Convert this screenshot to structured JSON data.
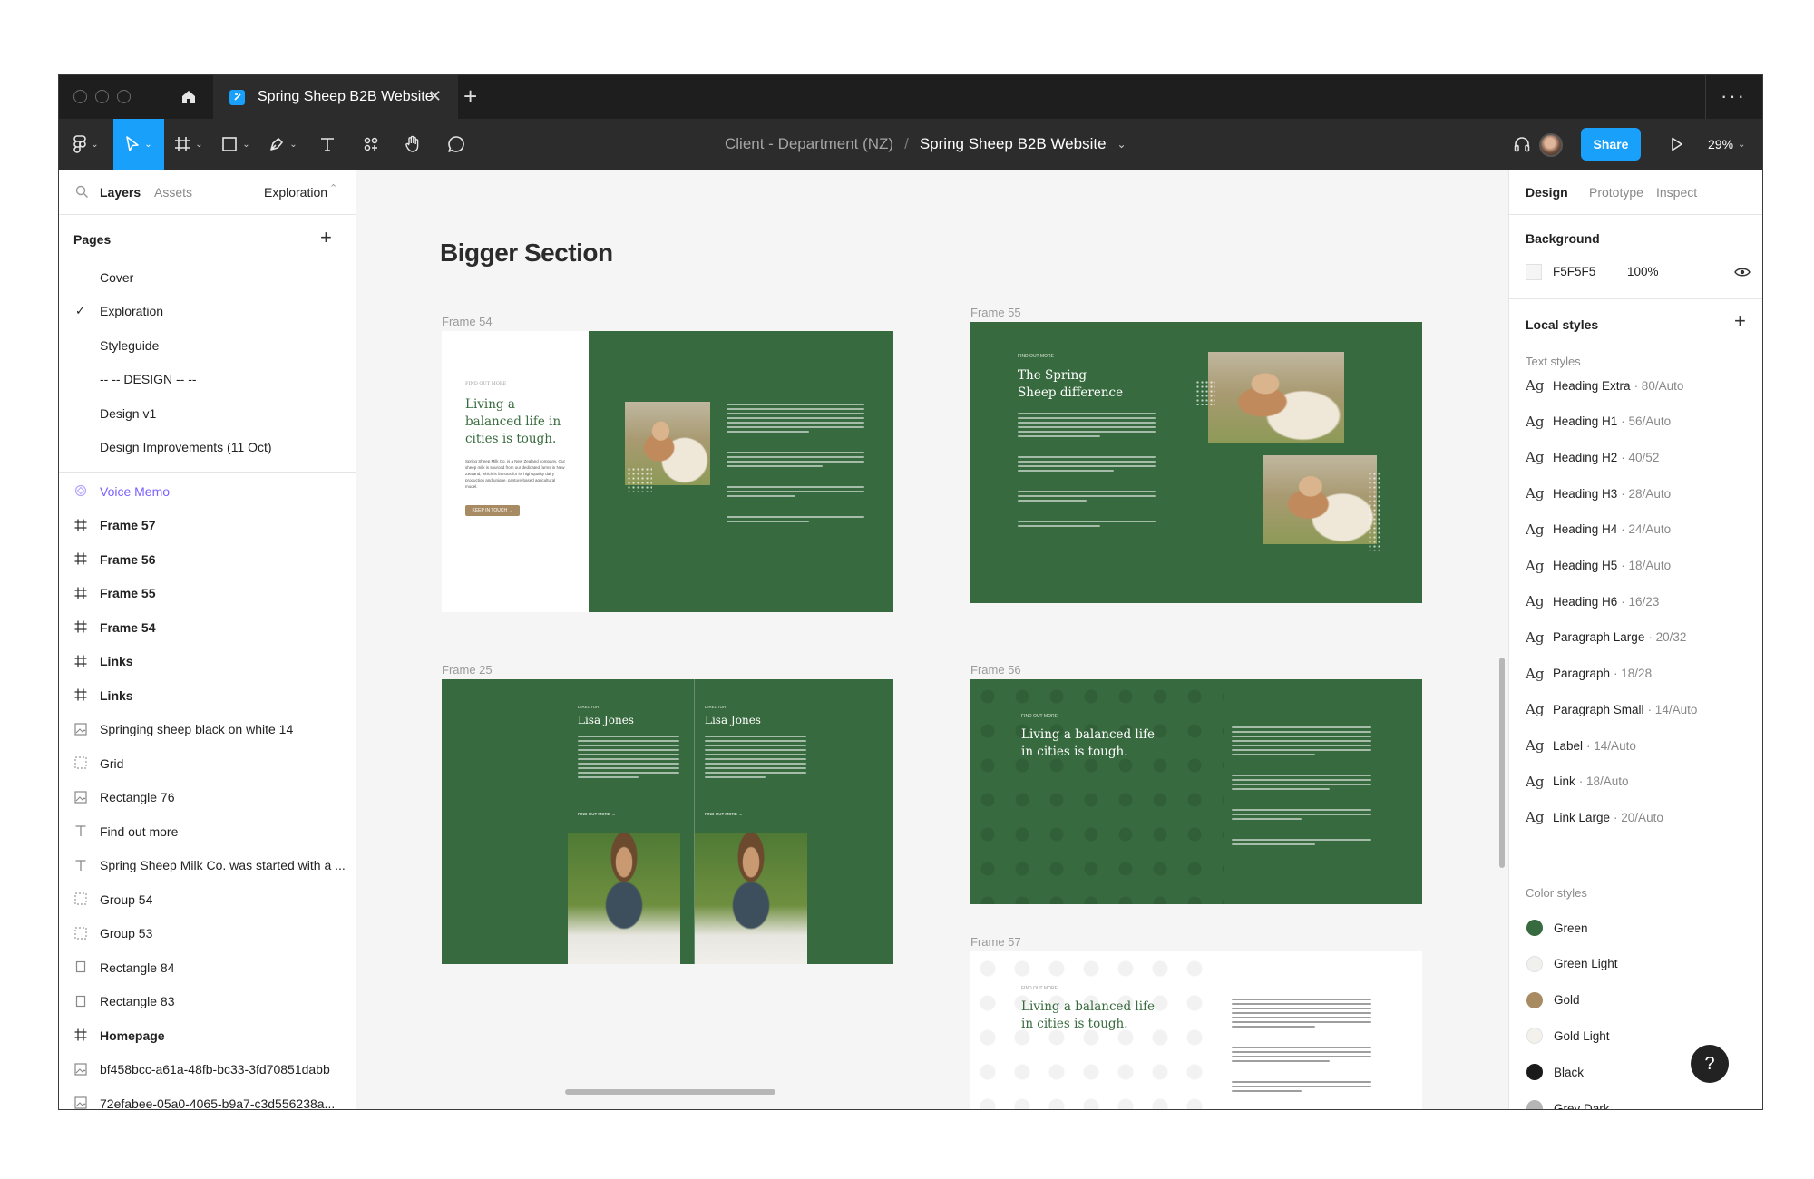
{
  "window": {
    "tab_title": "Spring Sheep B2B Website",
    "tab_close": "✕",
    "new_tab": "+",
    "more": "···"
  },
  "toolbar": {
    "breadcrumb_department": "Client - Department (NZ)",
    "breadcrumb_sep": "/",
    "breadcrumb_file": "Spring Sheep B2B Website",
    "share_label": "Share",
    "zoom": "29%"
  },
  "left_panel": {
    "tabs": {
      "layers": "Layers",
      "assets": "Assets",
      "page_selector": "Exploration"
    },
    "pages_title": "Pages",
    "add": "+",
    "pages": [
      {
        "label": "Cover",
        "selected": false
      },
      {
        "label": "Exploration",
        "selected": true
      },
      {
        "label": "Styleguide",
        "selected": false
      },
      {
        "label": "-- -- DESIGN -- --",
        "selected": false
      },
      {
        "label": "Design v1",
        "selected": false
      },
      {
        "label": "Design Improvements (11 Oct)",
        "selected": false
      }
    ],
    "layers": [
      {
        "label": "Voice Memo",
        "icon": "component-icon"
      },
      {
        "label": "Frame 57",
        "icon": "frame-icon"
      },
      {
        "label": "Frame 56",
        "icon": "frame-icon"
      },
      {
        "label": "Frame 55",
        "icon": "frame-icon"
      },
      {
        "label": "Frame 54",
        "icon": "frame-icon"
      },
      {
        "label": "Links",
        "icon": "frame-icon"
      },
      {
        "label": "Links",
        "icon": "frame-icon"
      },
      {
        "label": "Springing sheep black on white 14",
        "icon": "image-icon"
      },
      {
        "label": "Grid",
        "icon": "group-icon"
      },
      {
        "label": "Rectangle 76",
        "icon": "image-icon"
      },
      {
        "label": "Find out more",
        "icon": "text-icon"
      },
      {
        "label": "Spring Sheep Milk Co. was started with a ...",
        "icon": "text-icon"
      },
      {
        "label": "Group 54",
        "icon": "group-icon"
      },
      {
        "label": "Group 53",
        "icon": "group-icon"
      },
      {
        "label": "Rectangle 84",
        "icon": "rectangle-icon"
      },
      {
        "label": "Rectangle 83",
        "icon": "rectangle-icon"
      },
      {
        "label": "Homepage",
        "icon": "frame-icon"
      },
      {
        "label": "bf458bcc-a61a-48fb-bc33-3fd70851dabb",
        "icon": "image-icon"
      },
      {
        "label": "72efabee-05a0-4065-b9a7-c3d556238a...",
        "icon": "image-icon"
      }
    ]
  },
  "canvas": {
    "section_title": "Bigger Section",
    "frames": {
      "f54": {
        "label": "Frame 54",
        "eyebrow": "FIND OUT MORE",
        "heading": "Living a balanced life in cities is tough.",
        "body": "Spring Sheep Milk Co. is a New Zealand company. Our sheep milk is sourced from our dedicated farms in New Zealand, which is famous for its high quality dairy production and unique, pasture-based agricultural model.",
        "button": "KEEP IN TOUCH →"
      },
      "f55": {
        "label": "Frame 55",
        "eyebrow": "FIND OUT MORE",
        "heading": "The Spring Sheep difference"
      },
      "f25": {
        "label": "Frame 25",
        "eyebrow": "DIRECTOR",
        "name": "Lisa Jones",
        "link": "FIND OUT MORE →"
      },
      "f56": {
        "label": "Frame 56",
        "eyebrow": "FIND OUT MORE",
        "heading": "Living a balanced life in cities is tough."
      },
      "f57": {
        "label": "Frame 57",
        "eyebrow": "FIND OUT MORE",
        "heading": "Living a balanced life in cities is tough."
      }
    }
  },
  "right_panel": {
    "tabs": {
      "design": "Design",
      "prototype": "Prototype",
      "inspect": "Inspect"
    },
    "background_title": "Background",
    "background_hex": "F5F5F5",
    "background_opacity": "100%",
    "local_styles_title": "Local styles",
    "text_styles_title": "Text styles",
    "text_styles": [
      {
        "name": "Heading Extra",
        "meta": "· 80/Auto"
      },
      {
        "name": "Heading H1",
        "meta": "· 56/Auto"
      },
      {
        "name": "Heading H2",
        "meta": "· 40/52"
      },
      {
        "name": "Heading H3",
        "meta": "· 28/Auto"
      },
      {
        "name": "Heading H4",
        "meta": "· 24/Auto"
      },
      {
        "name": "Heading H5",
        "meta": "· 18/Auto"
      },
      {
        "name": "Heading H6",
        "meta": "· 16/23"
      },
      {
        "name": "Paragraph Large",
        "meta": "· 20/32"
      },
      {
        "name": "Paragraph",
        "meta": "· 18/28"
      },
      {
        "name": "Paragraph Small",
        "meta": "· 14/Auto"
      },
      {
        "name": "Label",
        "meta": "· 14/Auto"
      },
      {
        "name": "Link",
        "meta": "· 18/Auto"
      },
      {
        "name": "Link Large",
        "meta": "· 20/Auto"
      }
    ],
    "ag": "Ag",
    "color_styles_title": "Color styles",
    "color_styles": [
      {
        "name": "Green",
        "color": "#376a3e"
      },
      {
        "name": "Green Light",
        "color": "#f0f0ee"
      },
      {
        "name": "Gold",
        "color": "#a88b62"
      },
      {
        "name": "Gold Light",
        "color": "#f3f1ec"
      },
      {
        "name": "Black",
        "color": "#1a1a1a"
      },
      {
        "name": "Grey Dark",
        "color": "#b5b5b5"
      }
    ],
    "help": "?"
  },
  "colors": {
    "accent": "#18a0fb",
    "brand_green": "#376a3e",
    "canvas_bg": "#F5F5F5"
  }
}
